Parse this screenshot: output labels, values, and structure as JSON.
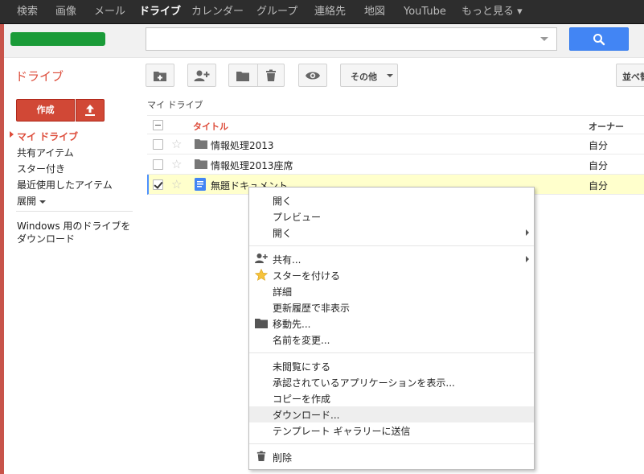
{
  "topnav": [
    {
      "label": "検索",
      "active": false
    },
    {
      "label": "画像",
      "active": false
    },
    {
      "label": "メール",
      "active": false
    },
    {
      "label": "ドライブ",
      "active": true
    },
    {
      "label": "カレンダー",
      "active": false
    },
    {
      "label": "グループ",
      "active": false
    },
    {
      "label": "連絡先",
      "active": false
    },
    {
      "label": "地図",
      "active": false
    },
    {
      "label": "YouTube",
      "active": false
    },
    {
      "label": "もっと見る ▾",
      "active": false
    }
  ],
  "search": {
    "value": "",
    "placeholder": ""
  },
  "app_title": "ドライブ",
  "toolbar": {
    "other_label": "その他",
    "sort_label": "並べ替"
  },
  "sidebar": {
    "create_label": "作成",
    "items": [
      {
        "label": "マイ ドライブ",
        "active": true
      },
      {
        "label": "共有アイテム",
        "active": false
      },
      {
        "label": "スター付き",
        "active": false
      },
      {
        "label": "最近使用したアイテム",
        "active": false
      },
      {
        "label": "展開",
        "active": false
      }
    ],
    "download_link": "Windows 用のドライブをダウンロード"
  },
  "list": {
    "breadcrumb": "マイ ドライブ",
    "columns": {
      "title": "タイトル",
      "owner": "オーナー"
    },
    "rows": [
      {
        "type": "folder",
        "name": "情報処理2013",
        "owner": "自分",
        "selected": false
      },
      {
        "type": "folder",
        "name": "情報処理2013座席",
        "owner": "自分",
        "selected": false
      },
      {
        "type": "document",
        "name": "無題ドキュメント",
        "owner": "自分",
        "selected": true
      }
    ]
  },
  "context_menu": {
    "groups": [
      [
        {
          "label": "開く",
          "icon": null,
          "submenu": false
        },
        {
          "label": "プレビュー",
          "icon": null,
          "submenu": false
        },
        {
          "label": "開く",
          "icon": null,
          "submenu": true
        }
      ],
      [
        {
          "label": "共有...",
          "icon": "share-person-icon",
          "submenu": true
        },
        {
          "label": "スターを付ける",
          "icon": "star-icon",
          "submenu": false
        },
        {
          "label": "詳細",
          "icon": null,
          "submenu": false
        },
        {
          "label": "更新履歴で非表示",
          "icon": null,
          "submenu": false
        },
        {
          "label": "移動先...",
          "icon": "folder-icon",
          "submenu": false
        },
        {
          "label": "名前を変更...",
          "icon": null,
          "submenu": false
        }
      ],
      [
        {
          "label": "未閲覧にする",
          "icon": null,
          "submenu": false
        },
        {
          "label": "承認されているアプリケーションを表示...",
          "icon": null,
          "submenu": false
        },
        {
          "label": "コピーを作成",
          "icon": null,
          "submenu": false
        },
        {
          "label": "ダウンロード...",
          "icon": null,
          "submenu": false,
          "hover": true
        },
        {
          "label": "テンプレート ギャラリーに送信",
          "icon": null,
          "submenu": false
        }
      ],
      [
        {
          "label": "削除",
          "icon": "trash-icon",
          "submenu": false
        }
      ]
    ]
  },
  "colors": {
    "accent_red": "#dd4b39",
    "create_red": "#d14836",
    "search_blue": "#4285f4",
    "selected_row": "#ffffcc",
    "topbar": "#2d2d2d"
  }
}
